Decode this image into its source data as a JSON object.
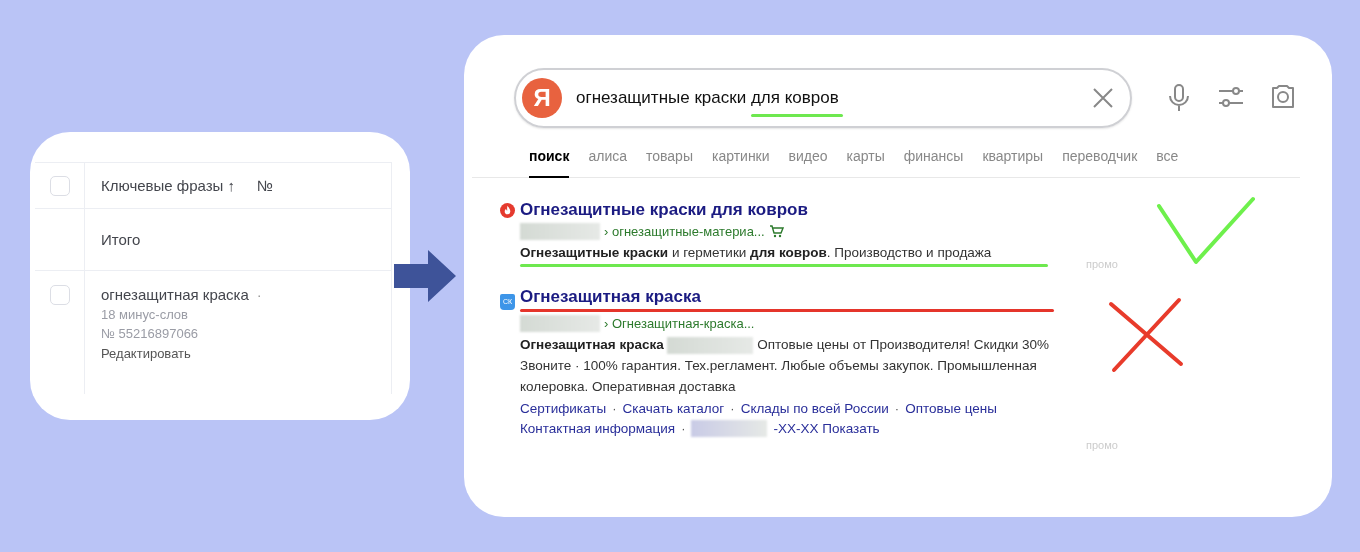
{
  "keywords_panel": {
    "header": {
      "checked": false,
      "title": "Ключевые фразы ↑",
      "number_column": "№"
    },
    "total_label": "Итого",
    "rows": [
      {
        "checked": false,
        "phrase": "огнезащитная краска",
        "dot": "·",
        "minus_words": "18 минус-слов",
        "id": "№ 55216897066",
        "edit_link": "Редактировать"
      }
    ]
  },
  "search": {
    "logo": "Я",
    "query_start": "огнезащитные краски ",
    "query_marked": "для ковров"
  },
  "tabs": [
    {
      "label": "поиск",
      "selected": true
    },
    {
      "label": "алиса",
      "selected": false
    },
    {
      "label": "товары",
      "selected": false
    },
    {
      "label": "картинки",
      "selected": false
    },
    {
      "label": "видео",
      "selected": false
    },
    {
      "label": "карты",
      "selected": false
    },
    {
      "label": "финансы",
      "selected": false
    },
    {
      "label": "квартиры",
      "selected": false
    },
    {
      "label": "переводчик",
      "selected": false
    },
    {
      "label": "все",
      "selected": false
    }
  ],
  "results": [
    {
      "kind": "good",
      "title": "Огнезащитные краски для ковров",
      "breadcrumb": "› огнезащитные-материа...",
      "cart": true,
      "promo": "промо",
      "snippet": [
        {
          "kind": "text",
          "text": "**Огнезащитные краски** и герметики **для ковров**. Производство и продажа"
        }
      ]
    },
    {
      "kind": "bad",
      "favicon_text": "СК",
      "title": "Огнезащитная краска",
      "breadcrumb": "› Огнезащитная-краска...",
      "cart": false,
      "promo": "промо",
      "snippet": [
        {
          "kind": "text",
          "text": "**Огнезащитная краска**"
        },
        {
          "kind": "redacted"
        },
        {
          "kind": "text",
          "text": "Оптовые цены от Производителя! Скидки 30% Звоните · 100% гарантия. Тех.регламент. Любые объемы закупок. Промышленная колеровка. Оперативная доставка"
        }
      ],
      "sitelink_rows": [
        [
          {
            "kind": "link",
            "text": "Сертификаты"
          },
          {
            "kind": "sep",
            "text": "·"
          },
          {
            "kind": "link",
            "text": "Скачать каталог"
          },
          {
            "kind": "sep",
            "text": "·"
          },
          {
            "kind": "link",
            "text": "Склады по всей России"
          },
          {
            "kind": "sep",
            "text": "·"
          },
          {
            "kind": "link",
            "text": "Оптовые цены"
          }
        ],
        [
          {
            "kind": "link",
            "text": "Контактная информация"
          },
          {
            "kind": "sep",
            "text": "·"
          },
          {
            "kind": "redacted"
          },
          {
            "kind": "link",
            "text": "-XX-XX Показать"
          }
        ]
      ]
    }
  ]
}
